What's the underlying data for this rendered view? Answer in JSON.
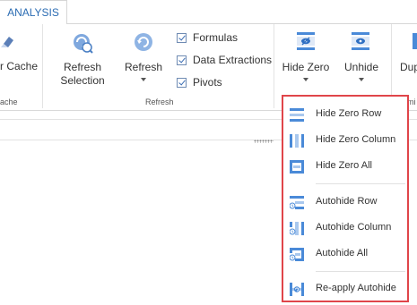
{
  "tabs": [
    {
      "label": "ANALYSIS"
    }
  ],
  "ribbon": {
    "cache": {
      "button_label": "r Cache",
      "group_label": "ache"
    },
    "refresh_group": {
      "refresh_selection": {
        "line1": "Refresh",
        "line2": "Selection"
      },
      "refresh": {
        "label": "Refresh"
      },
      "checkboxes": [
        {
          "label": "Formulas",
          "checked": true
        },
        {
          "label": "Data Extractions",
          "checked": true
        },
        {
          "label": "Pivots",
          "checked": true
        }
      ],
      "group_label": "Refresh"
    },
    "hide_zero": {
      "label": "Hide Zero"
    },
    "unhide": {
      "label": "Unhide"
    },
    "next_button": {
      "label": "Dup"
    },
    "next_group_label": "mi"
  },
  "menu": {
    "items": [
      {
        "label": "Hide Zero Row",
        "icon": "hide-zero-row-icon"
      },
      {
        "label": "Hide Zero Column",
        "icon": "hide-zero-column-icon"
      },
      {
        "label": "Hide Zero All",
        "icon": "hide-zero-all-icon"
      },
      {
        "label": "Autohide Row",
        "icon": "autohide-row-icon"
      },
      {
        "label": "Autohide Column",
        "icon": "autohide-column-icon"
      },
      {
        "label": "Autohide All",
        "icon": "autohide-all-icon"
      },
      {
        "label": "Re-apply Autohide",
        "icon": "reapply-autohide-icon"
      }
    ]
  },
  "colors": {
    "accent": "#2b6cb3",
    "highlight_border": "#e0454a",
    "icon_blue": "#4a8ad8",
    "icon_light": "#a9c8ee"
  }
}
